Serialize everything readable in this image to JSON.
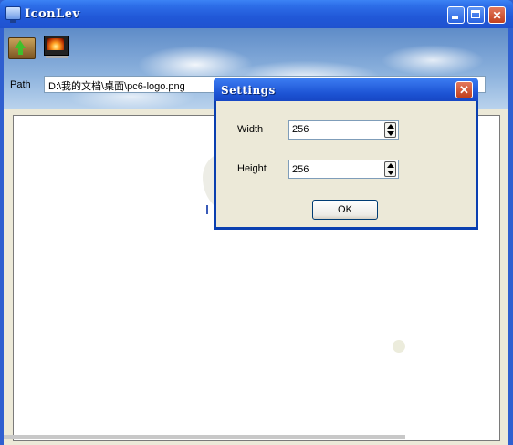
{
  "window": {
    "title": "IconLev"
  },
  "toolbar": {
    "open_icon": "open-folder-icon",
    "image_icon": "picture-icon"
  },
  "path": {
    "label": "Path",
    "value": "D:\\我的文档\\桌面\\pc6-logo.png"
  },
  "dialog": {
    "title": "Settings",
    "width_label": "Width",
    "width_value": "256",
    "height_label": "Height",
    "height_value": "256",
    "ok_label": "OK"
  },
  "colors": {
    "titlebar": "#2158d8",
    "close": "#c1401e",
    "window_face": "#ece9d8"
  }
}
